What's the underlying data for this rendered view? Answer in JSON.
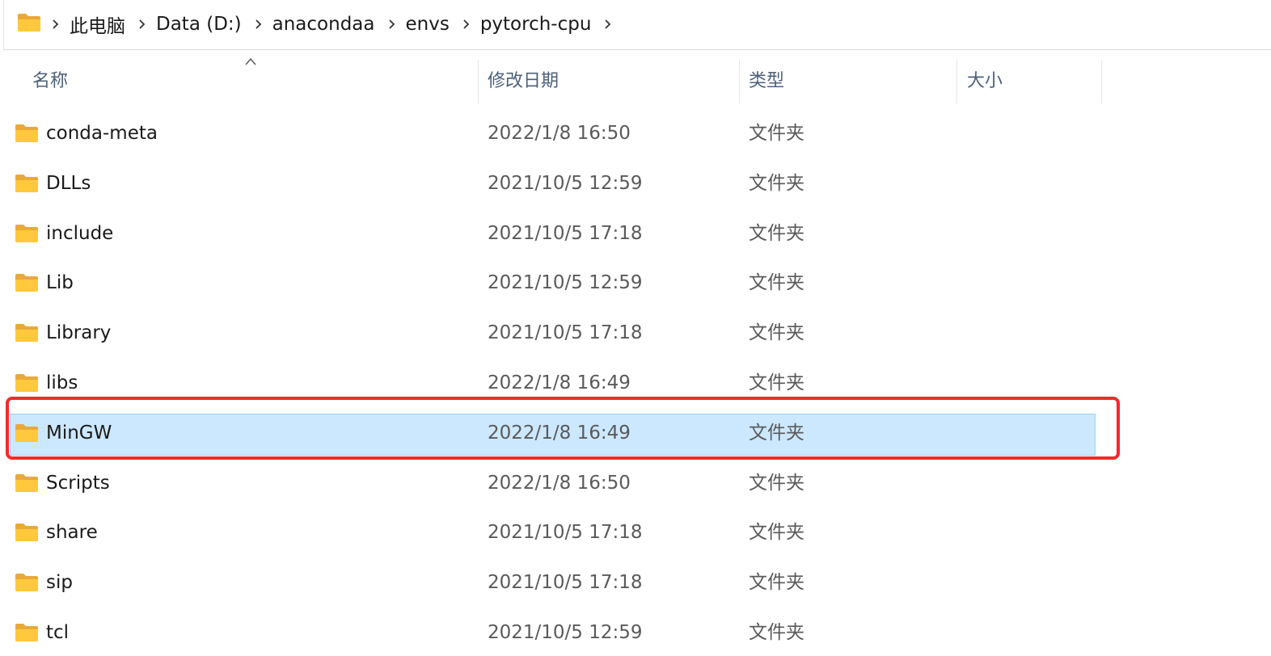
{
  "breadcrumb": {
    "icon": "folder-icon",
    "items": [
      "此电脑",
      "Data (D:)",
      "anacondaa",
      "envs",
      "pytorch-cpu"
    ]
  },
  "columns": {
    "name": "名称",
    "date": "修改日期",
    "type": "类型",
    "size": "大小"
  },
  "rows": [
    {
      "name": "conda-meta",
      "date": "2022/1/8 16:50",
      "type": "文件夹"
    },
    {
      "name": "DLLs",
      "date": "2021/10/5 12:59",
      "type": "文件夹"
    },
    {
      "name": "include",
      "date": "2021/10/5 17:18",
      "type": "文件夹"
    },
    {
      "name": "Lib",
      "date": "2021/10/5 12:59",
      "type": "文件夹"
    },
    {
      "name": "Library",
      "date": "2021/10/5 17:18",
      "type": "文件夹"
    },
    {
      "name": "libs",
      "date": "2022/1/8 16:49",
      "type": "文件夹"
    },
    {
      "name": "MinGW",
      "date": "2022/1/8 16:49",
      "type": "文件夹"
    },
    {
      "name": "Scripts",
      "date": "2022/1/8 16:50",
      "type": "文件夹"
    },
    {
      "name": "share",
      "date": "2021/10/5 17:18",
      "type": "文件夹"
    },
    {
      "name": "sip",
      "date": "2021/10/5 17:18",
      "type": "文件夹"
    },
    {
      "name": "tcl",
      "date": "2021/10/5 12:59",
      "type": "文件夹"
    }
  ],
  "selected_row": "MinGW",
  "colors": {
    "selection_fill": "#cce8ff",
    "selection_border": "#99d1ff",
    "annotation_red": "#ef2b2b",
    "folder_yellow": "#ffc83d"
  }
}
